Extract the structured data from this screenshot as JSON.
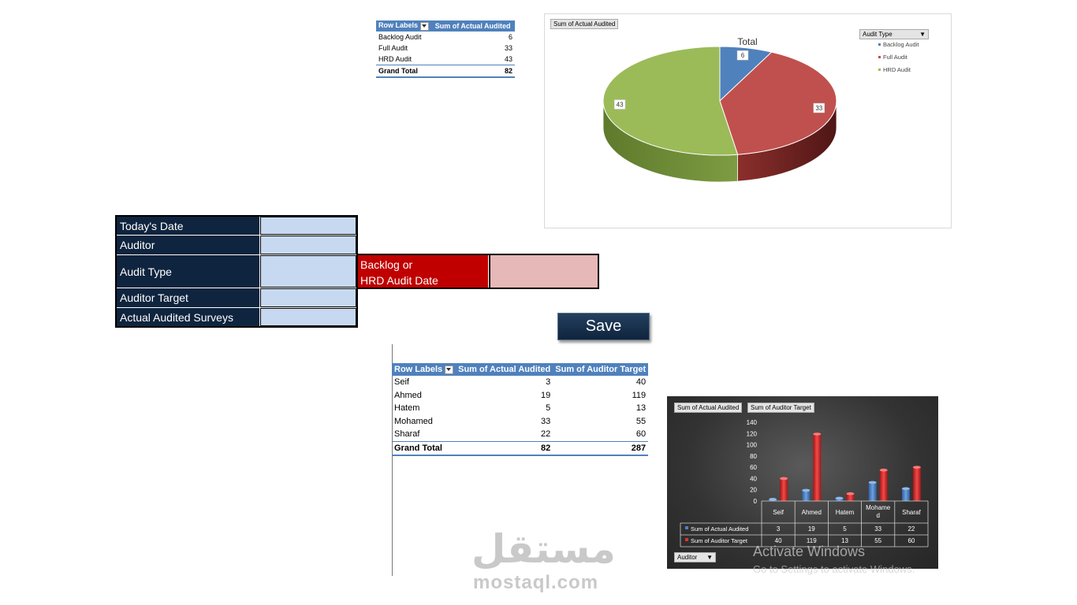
{
  "top_pivot": {
    "header_labels": "Row Labels",
    "header_values": "Sum of Actual Audited",
    "rows": [
      {
        "label": "Backlog Audit",
        "value": "6"
      },
      {
        "label": "Full Audit",
        "value": "33"
      },
      {
        "label": "HRD Audit",
        "value": "43"
      }
    ],
    "total_label": "Grand Total",
    "total_value": "82"
  },
  "pie_chart_panel": {
    "field_button": "Sum of Actual Audited",
    "filter_button": "Audit Type"
  },
  "form": {
    "todays_date": "Today's Date",
    "auditor": "Auditor",
    "audit_type": "Audit Type",
    "auditor_target": "Auditor Target",
    "actual_audited": "Actual Audited Surveys",
    "backlog_line1": "Backlog or",
    "backlog_line2": "HRD Audit Date",
    "save": "Save"
  },
  "bottom_pivot": {
    "header_labels": "Row Labels",
    "header_actual": "Sum of Actual Audited",
    "header_target": "Sum of Auditor Target",
    "rows": [
      {
        "label": "Seif",
        "actual": "3",
        "target": "40"
      },
      {
        "label": "Ahmed",
        "actual": "19",
        "target": "119"
      },
      {
        "label": "Hatem",
        "actual": "5",
        "target": "13"
      },
      {
        "label": "Mohamed",
        "actual": "33",
        "target": "55"
      },
      {
        "label": "Sharaf",
        "actual": "22",
        "target": "60"
      }
    ],
    "total_label": "Grand Total",
    "total_actual": "82",
    "total_target": "287"
  },
  "bar_chart_panel": {
    "field_button_1": "Sum of Actual Audited",
    "field_button_2": "Sum of Auditor Target",
    "axis_button": "Auditor"
  },
  "chart_data": [
    {
      "type": "pie",
      "title": "Total",
      "categories": [
        "Backlog Audit",
        "Full Audit",
        "HRD Audit"
      ],
      "values": [
        6,
        33,
        43
      ],
      "colors": [
        "#4f81bd",
        "#c0504d",
        "#9bbb59"
      ],
      "legend": "top-right"
    },
    {
      "type": "bar",
      "categories": [
        "Seif",
        "Ahmed",
        "Hatem",
        "Mohamed",
        "Sharaf"
      ],
      "category_display": [
        "Seif",
        "Ahmed",
        "Hatem",
        "Moham­e d",
        "Sharaf"
      ],
      "series": [
        {
          "name": "Sum of Actual Audited",
          "values": [
            3,
            19,
            5,
            33,
            22
          ],
          "color": "#4f81bd"
        },
        {
          "name": "Sum of Auditor Target",
          "values": [
            40,
            119,
            13,
            55,
            60
          ],
          "color": "#e03030"
        }
      ],
      "yticks": [
        "0",
        "20",
        "40",
        "60",
        "80",
        "100",
        "120",
        "140"
      ],
      "ylim": [
        0,
        140
      ],
      "grid": false,
      "data_table": true
    }
  ],
  "watermark": {
    "arabic": "مستقل",
    "latin": "mostaql.com"
  },
  "windows_activation": {
    "title": "Activate Windows",
    "subtitle": "Go to Settings to activate Windows."
  }
}
